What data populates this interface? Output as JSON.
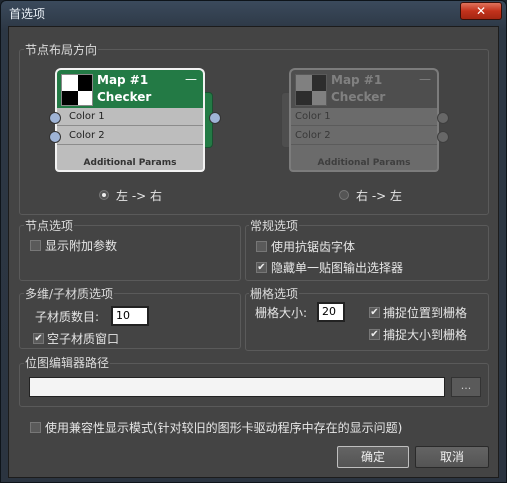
{
  "window": {
    "title": "首选项",
    "close_label": "✕"
  },
  "layout_group": {
    "label": "节点布局方向",
    "node": {
      "map_title": "Map #1",
      "map_type": "Checker",
      "minimize": "—",
      "rows": [
        "Color 1",
        "Color 2"
      ],
      "additional": "Additional Params",
      "plus": "+"
    },
    "option_left": "左 -> 右",
    "option_right": "右 -> 左",
    "selected": "left"
  },
  "node_options": {
    "label": "节点选项",
    "show_extra_params": {
      "label": "显示附加参数",
      "checked": false
    }
  },
  "general_options": {
    "label": "常规选项",
    "antialias": {
      "label": "使用抗锯齿字体",
      "checked": false
    },
    "hide_single_output": {
      "label": "隐藏单一贴图输出选择器",
      "checked": true
    }
  },
  "multi_sub": {
    "label": "多维/子材质选项",
    "count_label": "子材质数目:",
    "count_value": "10",
    "empty_window": {
      "label": "空子材质窗口",
      "checked": true
    }
  },
  "grid_options": {
    "label": "栅格选项",
    "size_label": "栅格大小:",
    "size_value": "20",
    "snap_position": {
      "label": "捕捉位置到栅格",
      "checked": true
    },
    "snap_size": {
      "label": "捕捉大小到栅格",
      "checked": true
    }
  },
  "bitmap_editor": {
    "label": "位图编辑器路径",
    "path_value": "",
    "browse_label": "..."
  },
  "compat_mode": {
    "label": "使用兼容性显示模式(针对较旧的图形卡驱动程序中存在的显示问题)",
    "checked": false
  },
  "buttons": {
    "ok": "确定",
    "cancel": "取消"
  }
}
